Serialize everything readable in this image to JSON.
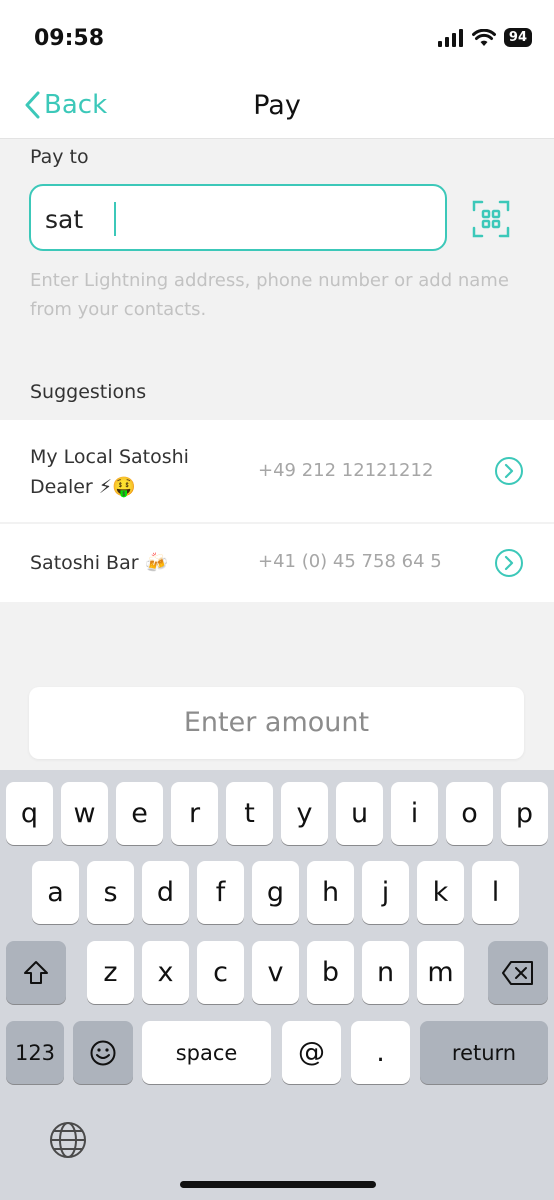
{
  "status_bar": {
    "time": "09:58",
    "battery": "94"
  },
  "nav": {
    "back_label": "Back",
    "title": "Pay"
  },
  "pay_to": {
    "label": "Pay to",
    "value": "sat",
    "hint": "Enter Lightning address, phone number or add name from your contacts."
  },
  "suggestions": {
    "label": "Suggestions",
    "items": [
      {
        "name": "My Local Satoshi Dealer ⚡🤑",
        "phone": "+49 212 12121212"
      },
      {
        "name": "Satoshi Bar 🍻",
        "phone": "+41 (0) 45 758 64 5"
      }
    ]
  },
  "amount": {
    "label": "Enter amount"
  },
  "keyboard": {
    "row1": [
      "q",
      "w",
      "e",
      "r",
      "t",
      "y",
      "u",
      "i",
      "o",
      "p"
    ],
    "row2": [
      "a",
      "s",
      "d",
      "f",
      "g",
      "h",
      "j",
      "k",
      "l"
    ],
    "row3": [
      "z",
      "x",
      "c",
      "v",
      "b",
      "n",
      "m"
    ],
    "numbers_label": "123",
    "space_label": "space",
    "at_label": "@",
    "dot_label": ".",
    "return_label": "return"
  },
  "colors": {
    "accent": "#3cc8b9"
  },
  "icons": {
    "back": "chevron-left-icon",
    "scan": "qr-scan-icon",
    "arrow": "arrow-right-circle-icon",
    "shift": "shift-icon",
    "delete": "backspace-icon",
    "emoji": "emoji-icon",
    "globe": "globe-icon"
  }
}
